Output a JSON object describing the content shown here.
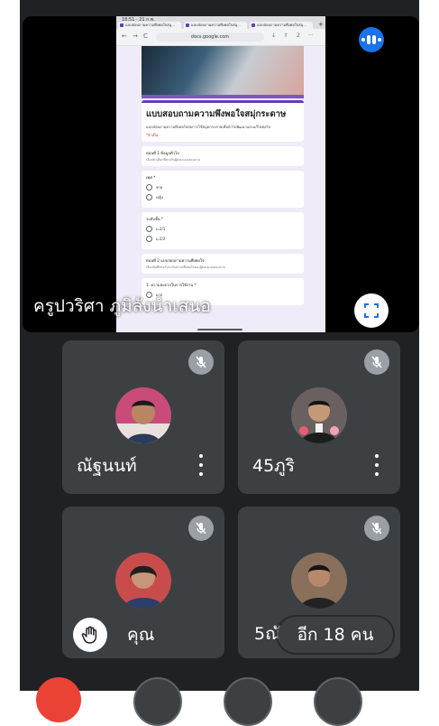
{
  "presenter": {
    "name": "ครูปวริศา ภูมิลังนำเสนอ",
    "shared_screen": {
      "status_time": "18:51 · 21 ก.พ.",
      "tabs": [
        "แบบสอบถามความพึงพอใจสมุ...",
        "แบบสอบถามความพึงพอใจสมุ...",
        "แบบสอบถามความพึงพอใจสมุ..."
      ],
      "new_tab_glyph": "+",
      "url": "docs.google.com",
      "nav_glyphs": [
        "←",
        "→",
        "C"
      ],
      "bar_glyphs": [
        "↓",
        "⇧",
        "2",
        "···"
      ],
      "form": {
        "title": "แบบสอบถามความพึงพอใจสมุ่กระดาษ",
        "description": "แบบสอบถามความพึงพอใจต่อการใช้สมุดกระดาษเพื่อนำไปพัฒนาและแก้ไขต่อไป",
        "required_note": "*จำเป็น",
        "section1_title": "ตอนที่ 1 ข้อมูลทั่วไป",
        "section1_desc": "เลือกตัวเลือกที่ตรงกับผู้ตอบแบบสอบถาม",
        "q_gender": "เพศ *",
        "gender_options": [
          "ชาย",
          "หญิง"
        ],
        "q_level": "ระดับชั้น *",
        "level_options": [
          "ม.2/1",
          "ม.2/2"
        ],
        "section2_title": "ตอนที่ 2 แบบสอบถามความพึงพอใจ",
        "section2_desc": "เลือกข้อที่ตรงกับระดับความพึงพอใจของผู้ตอบแบบสอบถาม",
        "q_next": "1. ความสะดวกในการใช้งาน *",
        "next_options": [
          "มาก"
        ]
      }
    }
  },
  "participants": [
    {
      "name": "ณัฐนนท์",
      "avatar_icon": "participant-photo-icon",
      "muted": true
    },
    {
      "name": "45ภูริ",
      "avatar_icon": "participant-photo-icon",
      "muted": true
    },
    {
      "name": "คุณ",
      "avatar_icon": "participant-photo-icon",
      "muted": true,
      "hand_raised": true
    },
    {
      "name": "5ณัฐวุฒิ",
      "avatar_icon": "participant-photo-icon",
      "muted": true
    }
  ],
  "others_label": "อีก 18 คน",
  "colors": {
    "background": "#202124",
    "tile": "#3c4043",
    "accent_blue": "#1a73e8",
    "end_call_red": "#ea4335",
    "form_purple": "#673ab7"
  },
  "icons": [
    "meet-dots-icon",
    "fullscreen-icon",
    "mic-off-icon",
    "more-vert-icon",
    "raise-hand-icon"
  ]
}
